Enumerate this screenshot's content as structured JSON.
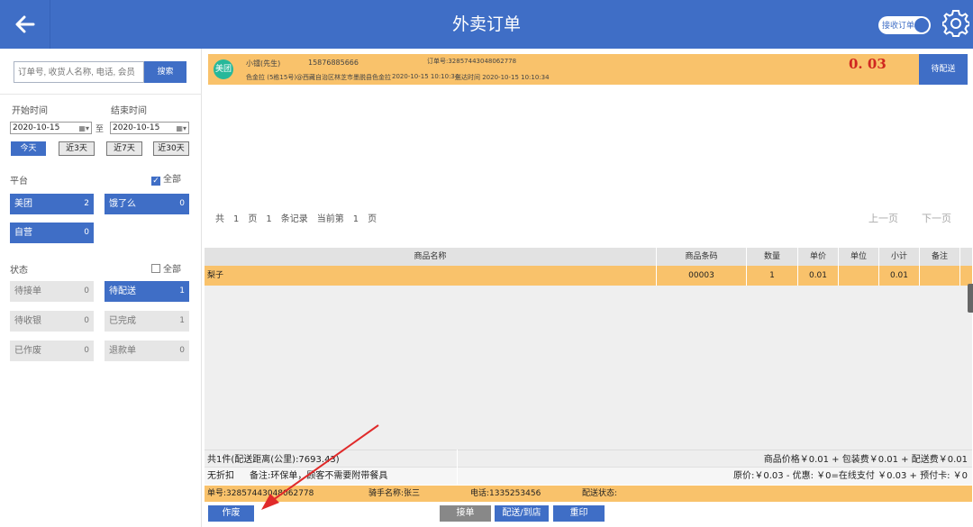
{
  "header": {
    "title": "外卖订单",
    "toggle_label": "接收订单",
    "colors": {
      "primary": "#3f6ec6",
      "accent": "#f9c26b",
      "price": "#d0271f"
    }
  },
  "search": {
    "placeholder": "订单号, 收货人名称, 电话, 会员",
    "button": "搜索"
  },
  "dates": {
    "start_label": "开始时间",
    "end_label": "结束时间",
    "start_value": "2020-10-15",
    "end_value": "2020-10-15",
    "separator": "至",
    "quick": [
      "今天",
      "近3天",
      "近7天",
      "近30天"
    ]
  },
  "platform": {
    "label": "平台",
    "all_label": "全部",
    "items": [
      {
        "name": "美团",
        "count": "2"
      },
      {
        "name": "饿了么",
        "count": "0"
      },
      {
        "name": "自营",
        "count": "0"
      }
    ]
  },
  "status": {
    "label": "状态",
    "all_label": "全部",
    "items": [
      {
        "name": "待接单",
        "count": "0"
      },
      {
        "name": "待配送",
        "count": "1"
      },
      {
        "name": "待收银",
        "count": "0"
      },
      {
        "name": "已完成",
        "count": "1"
      },
      {
        "name": "已作废",
        "count": "0"
      },
      {
        "name": "退款单",
        "count": "0"
      }
    ]
  },
  "order_card": {
    "logo": "美团",
    "customer": "小镭(先生)",
    "phone": "15876885666",
    "order_no": "订单号:32857443048062778",
    "address": "色金拉 (5栋15号)@西藏自治区林芝市墨脱县色金拉",
    "order_time": "2020-10-15 10:10:34",
    "delivery_time": "送达时间 2020-10-15 10:10:34",
    "amount": "0. 03",
    "status_button": "待配送"
  },
  "pager": {
    "text": "共　1　页　1　条记录　当前第　1　页",
    "prev": "上一页",
    "next": "下一页"
  },
  "table": {
    "headers": [
      "商品名称",
      "商品条码",
      "数量",
      "单价",
      "单位",
      "小计",
      "备注"
    ],
    "rows": [
      {
        "name": "梨子",
        "barcode": "00003",
        "qty": "1",
        "price": "0.01",
        "unit": "",
        "subtotal": "0.01",
        "note": ""
      }
    ]
  },
  "summary": {
    "count_distance": "共1件(配送距离(公里):7693.43)",
    "price_breakdown": "商品价格￥0.01 + 包装费￥0.01 + 配送费￥0.01",
    "discount": "无折扣",
    "remark": "备注:环保单，顾客不需要附带餐具",
    "payment": "原价:￥0.03 - 优惠: ￥0=在线支付 ￥0.03 + 预付卡: ￥0"
  },
  "info_bar": {
    "order_no": "单号:32857443048062778",
    "rider": "骑手名称:张三",
    "phone": "电话:1335253456",
    "delivery_status": "配送状态:"
  },
  "actions": {
    "void": "作废",
    "accept": "接单",
    "deliver": "配送/到店",
    "reprint": "重印"
  }
}
